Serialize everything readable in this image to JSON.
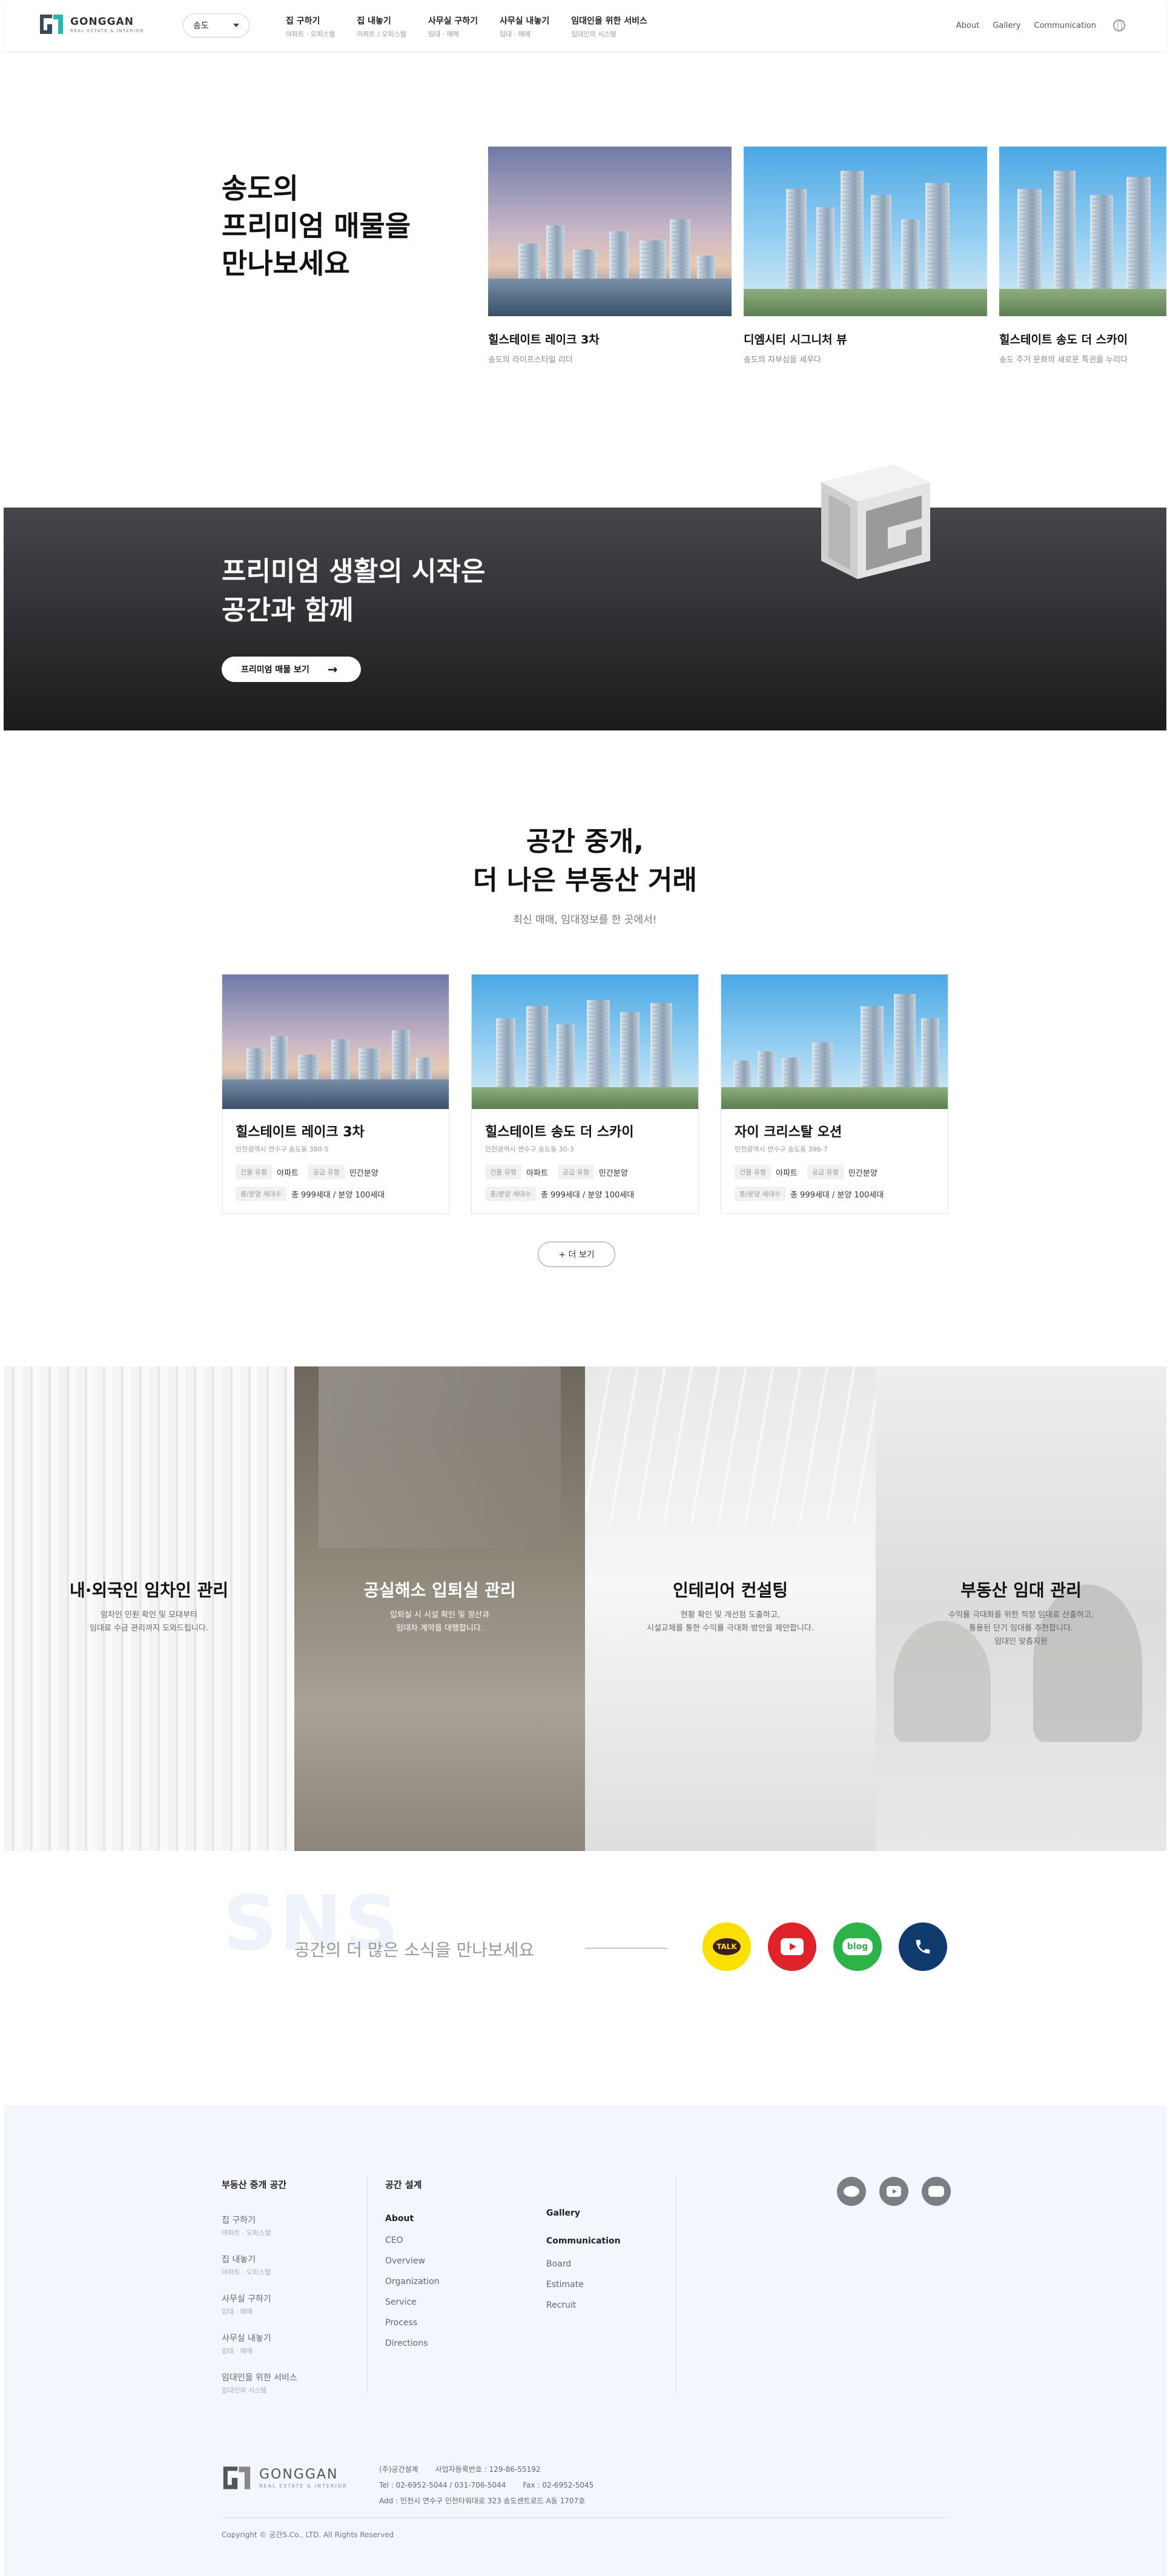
{
  "header": {
    "logo_title": "GONGGAN",
    "logo_sub": "REAL ESTATE & INTERIOR",
    "region": "송도",
    "nav": [
      {
        "main": "집 구하기",
        "sub": "아파트 · 오피스텔"
      },
      {
        "main": "집 내놓기",
        "sub": "아파트 / 오피스텔"
      },
      {
        "main": "사무실 구하기",
        "sub": "임대 · 매매"
      },
      {
        "main": "사무실 내놓기",
        "sub": "임대 · 매매"
      },
      {
        "main": "임대인을 위한 서비스",
        "sub": "임대인의 시스템"
      }
    ],
    "util": [
      "About",
      "Gallery",
      "Communication"
    ]
  },
  "hero": {
    "title_lines": [
      "송도의",
      "프리미엄 매물을",
      "만나보세요"
    ],
    "cards": [
      {
        "title": "힐스테이트 레이크 3차",
        "sub": "송도의 라이프스타일 리더"
      },
      {
        "title": "디엠시티 시그니처 뷰",
        "sub": "송도의 자부심을 세우다"
      },
      {
        "title": "힐스테이트 송도 더 스카이",
        "sub": "송도 주거 문화의 새로운 특권을 누리다"
      }
    ]
  },
  "banner": {
    "title_lines": [
      "프리미엄 생활의 시작은",
      "공간과 함께"
    ],
    "button": "프리미엄 매물 보기",
    "button_arrow": "→"
  },
  "listing": {
    "title_lines": [
      "공간 중개,",
      "더 나은 부동산 거래"
    ],
    "subtitle": "최신 매매, 임대정보를 한 곳에서!",
    "cards": [
      {
        "title": "힐스테이트 레이크 3차",
        "addr": "인천광역시 연수구 송도동 380-5",
        "tag1": "건물 유형",
        "val1": "아파트",
        "tag2": "공급 유형",
        "val2": "민간분양",
        "tag3": "총/분양 세대수",
        "val3": "총 999세대 / 분양 100세대"
      },
      {
        "title": "힐스테이트 송도 더 스카이",
        "addr": "인천광역시 연수구 송도동 30-3",
        "tag1": "건물 유형",
        "val1": "아파트",
        "tag2": "공급 유형",
        "val2": "민간분양",
        "tag3": "총/분양 세대수",
        "val3": "총 999세대 / 분양 100세대"
      },
      {
        "title": "자이 크리스탈 오션",
        "addr": "인천광역시 연수구 송도동 396-7",
        "tag1": "건물 유형",
        "val1": "아파트",
        "tag2": "공급 유형",
        "val2": "민간분양",
        "tag3": "총/분양 세대수",
        "val3": "총 999세대 / 분양 100세대"
      }
    ],
    "more": "+ 더 보기"
  },
  "services": [
    {
      "title": "내·외국인 임차인 관리",
      "desc1": "임차인 민원 확인 및 모대부터",
      "desc2": "임대료 수금 관리까지 도와드립니다."
    },
    {
      "title": "공실해소 입퇴실 관리",
      "desc1": "입퇴실 시 시설 확인 및 정산과",
      "desc2": "임대차 계약을 대행합니다."
    },
    {
      "title": "인테리어 컨설팅",
      "desc1": "현황 확인 및 개선점 도출하고,",
      "desc2": "시설교체를 통한 수익률 극대화 방안을 제안합니다."
    },
    {
      "title": "부동산 임대 관리",
      "desc1": "수익률 극대화를 위한 적정 임대료 산출하고,",
      "desc2": "통용된 단기 임대를 추천합니다.",
      "desc3": "임대인 맞춤지원"
    }
  ],
  "sns": {
    "bg_text": "SNS",
    "text": "공간의 더 많은 소식을 만나보세요",
    "kakao": "TALK",
    "blog": "blog",
    "colors": {
      "kakao": "#f9e000",
      "youtube": "#e0232b",
      "blog": "#2db34a",
      "phone": "#0e3a6e"
    }
  },
  "footer": {
    "col1_title": "부동산 중개 공간",
    "col1_links": [
      {
        "main": "집 구하기",
        "sub": "아파트 · 오피스텔"
      },
      {
        "main": "집 내놓기",
        "sub": "아파트 · 오피스텔"
      },
      {
        "main": "사무실 구하기",
        "sub": "임대 · 매매"
      },
      {
        "main": "사무실 내놓기",
        "sub": "임대 · 매매"
      },
      {
        "main": "임대인을 위한 서비스",
        "sub": "임대인의 시스템"
      }
    ],
    "col2_title": "공간 설계",
    "about": "About",
    "about_links": [
      "CEO",
      "Overview",
      "Organization",
      "Service",
      "Process",
      "Directions"
    ],
    "gallery": "Gallery",
    "communication": "Communication",
    "comm_links": [
      "Board",
      "Estimate",
      "Recruit"
    ],
    "logo_title": "GONGGAN",
    "logo_sub": "REAL ESTATE & INTERIOR",
    "company": "(주)공간설계",
    "biz_no": "사업자등록번호 : 129-86-55192",
    "tel": "Tel : 02-6952-5044 / 031-706-5044",
    "fax": "Fax : 02-6952-5045",
    "addr": "Add : 인천시 연수구 인천타워대로 323 송도센트로드 A동 1707호",
    "copyright": "Copyright © 공간S.Co., LTD. All Rights Reserved"
  }
}
